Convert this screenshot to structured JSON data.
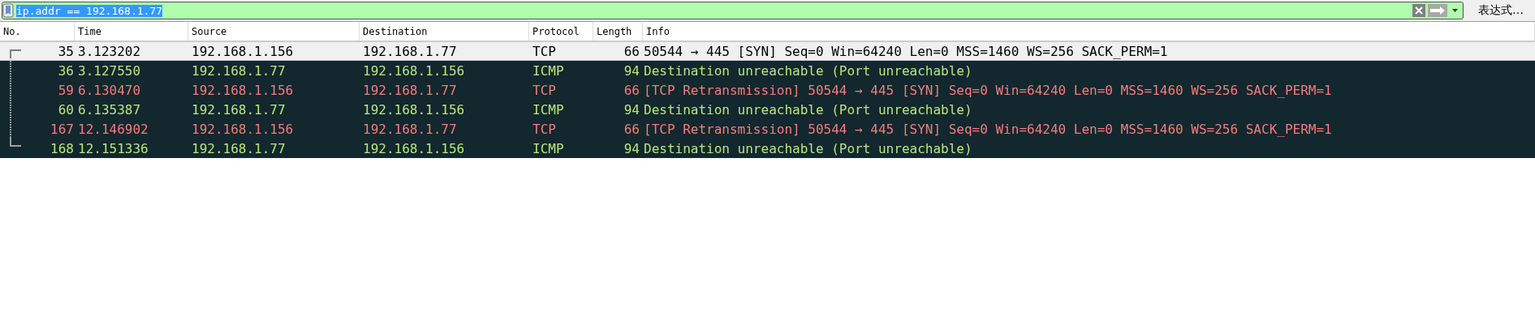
{
  "filter": {
    "value": "ip.addr == 192.168.1.77",
    "valid": true,
    "text_selected": true,
    "expression_button": "表达式…"
  },
  "columns": [
    "No.",
    "Time",
    "Source",
    "Destination",
    "Protocol",
    "Length",
    "Info"
  ],
  "rows": [
    {
      "no": "35",
      "time": "3.123202",
      "source": "192.168.1.156",
      "destination": "192.168.1.77",
      "protocol": "TCP",
      "length": "66",
      "info": "50544 → 445 [SYN] Seq=0 Win=64240 Len=0 MSS=1460 WS=256 SACK_PERM=1",
      "selected": true,
      "related": true
    },
    {
      "no": "36",
      "time": "3.127550",
      "source": "192.168.1.77",
      "destination": "192.168.1.156",
      "protocol": "ICMP",
      "length": "94",
      "info": "Destination unreachable (Port unreachable)",
      "kind": "icmp_error",
      "selected": false,
      "related": true
    },
    {
      "no": "59",
      "time": "6.130470",
      "source": "192.168.1.156",
      "destination": "192.168.1.77",
      "protocol": "TCP",
      "length": "66",
      "info": "[TCP Retransmission] 50544 → 445 [SYN] Seq=0 Win=64240 Len=0 MSS=1460 WS=256 SACK_PERM=1",
      "kind": "bad_tcp",
      "selected": false,
      "related": true
    },
    {
      "no": "60",
      "time": "6.135387",
      "source": "192.168.1.77",
      "destination": "192.168.1.156",
      "protocol": "ICMP",
      "length": "94",
      "info": "Destination unreachable (Port unreachable)",
      "kind": "icmp_error",
      "selected": false,
      "related": true
    },
    {
      "no": "167",
      "time": "12.146902",
      "source": "192.168.1.156",
      "destination": "192.168.1.77",
      "protocol": "TCP",
      "length": "66",
      "info": "[TCP Retransmission] 50544 → 445 [SYN] Seq=0 Win=64240 Len=0 MSS=1460 WS=256 SACK_PERM=1",
      "kind": "bad_tcp",
      "selected": false,
      "related": true
    },
    {
      "no": "168",
      "time": "12.151336",
      "source": "192.168.1.77",
      "destination": "192.168.1.156",
      "protocol": "ICMP",
      "length": "94",
      "info": "Destination unreachable (Port unreachable)",
      "kind": "icmp_error",
      "selected": false,
      "related": true
    }
  ]
}
